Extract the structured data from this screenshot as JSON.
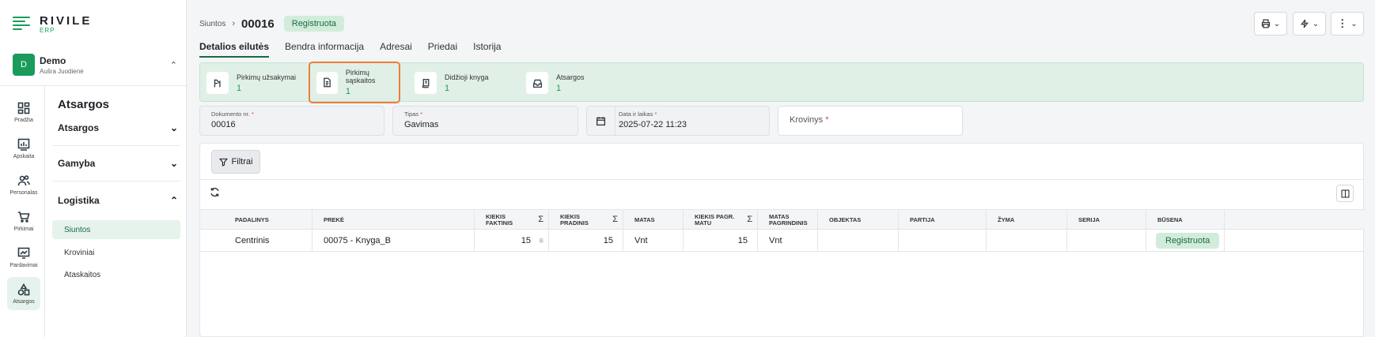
{
  "app": {
    "brand": "RIVILE",
    "brand_sub": "ERP",
    "colors": {
      "accent": "#1a9b5a",
      "accent_light": "#e0f0e6",
      "highlight": "#f07c3a"
    }
  },
  "org": {
    "initial": "D",
    "name": "Demo",
    "user": "Aušra Juodienė"
  },
  "rail": [
    {
      "label": "Pradžia",
      "icon": "dashboard-icon"
    },
    {
      "label": "Apskaita",
      "icon": "chart-icon"
    },
    {
      "label": "Personalas",
      "icon": "people-icon"
    },
    {
      "label": "Pirkimai",
      "icon": "cart-icon"
    },
    {
      "label": "Pardavimai",
      "icon": "sales-icon"
    },
    {
      "label": "Atsargos",
      "icon": "shapes-icon"
    }
  ],
  "menu": {
    "title": "Atsargos",
    "sections": [
      "Atsargos",
      "Gamyba",
      "Logistika"
    ],
    "subitems": [
      "Siuntos",
      "Kroviniai",
      "Ataskaitos"
    ]
  },
  "header": {
    "crumb_root": "Siuntos",
    "doc_number": "00016",
    "status": "Registruota"
  },
  "tabs": [
    "Detalios eilutės",
    "Bendra informacija",
    "Adresai",
    "Priedai",
    "Istorija"
  ],
  "related": [
    {
      "label": "Pirkimų užsakymai",
      "count": "1",
      "icon": "order-icon"
    },
    {
      "label": "Pirkimų sąskaitos",
      "count": "1",
      "icon": "invoice-icon"
    },
    {
      "label": "Didžioji knyga",
      "count": "1",
      "icon": "ledger-icon"
    },
    {
      "label": "Atsargos",
      "count": "1",
      "icon": "inbox-icon"
    }
  ],
  "fields": {
    "doc_no": {
      "label": "Dokumento nr.",
      "value": "00016"
    },
    "type": {
      "label": "Tipas",
      "value": "Gavimas"
    },
    "datetime": {
      "label": "Data ir laikas",
      "value": "2025-07-22 11:23"
    },
    "cargo": {
      "label": "Krovinys"
    }
  },
  "table": {
    "filter_label": "Filtrai",
    "columns": [
      "PADALINYS",
      "PREKĖ",
      "KIEKIS FAKTINIS",
      "KIEKIS PRADINIS",
      "MATAS",
      "KIEKIS PAGR. MATU",
      "MATAS PAGRINDINIS",
      "OBJEKTAS",
      "PARTIJA",
      "ŽYMA",
      "SERIJA",
      "BŪSENA"
    ],
    "rows": [
      {
        "padalinys": "Centrinis",
        "preke": "00075 - Knyga_B",
        "kiekis_faktinis": "15",
        "kiekis_pradinis": "15",
        "matas": "Vnt",
        "kiekis_pagr": "15",
        "matas_pagr": "Vnt",
        "objektas": "",
        "partija": "",
        "zyma": "",
        "serija": "",
        "busena": "Registruota"
      }
    ]
  }
}
